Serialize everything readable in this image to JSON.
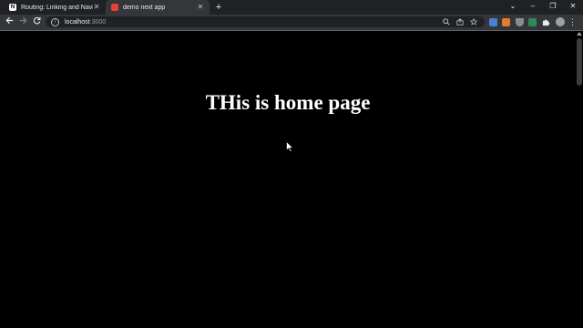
{
  "browser": {
    "tabs": [
      {
        "title": "Routing: Linking and Navigating",
        "favicon": "nextjs-icon",
        "active": false
      },
      {
        "title": "demo next app",
        "favicon": "app-icon",
        "active": true
      }
    ],
    "new_tab_symbol": "+",
    "tab_search_symbol": "⌄",
    "window_controls": {
      "minimize": "–",
      "restore": "❐",
      "close": "✕"
    },
    "address": {
      "host": "localhost",
      "port": ":3000"
    },
    "icons": [
      "back-icon",
      "forward-icon",
      "reload-icon",
      "info-icon",
      "zoom-icon",
      "share-icon",
      "bookmark-star-icon",
      "extension-icon",
      "puzzle-icon",
      "side-panel-icon",
      "profile-avatar",
      "menu-icon"
    ],
    "colors": {
      "tabstrip": "#202124",
      "toolbar": "#35363a",
      "page_bg": "#000000",
      "text": "#ffffff"
    }
  },
  "page": {
    "heading": "THis is home page"
  }
}
